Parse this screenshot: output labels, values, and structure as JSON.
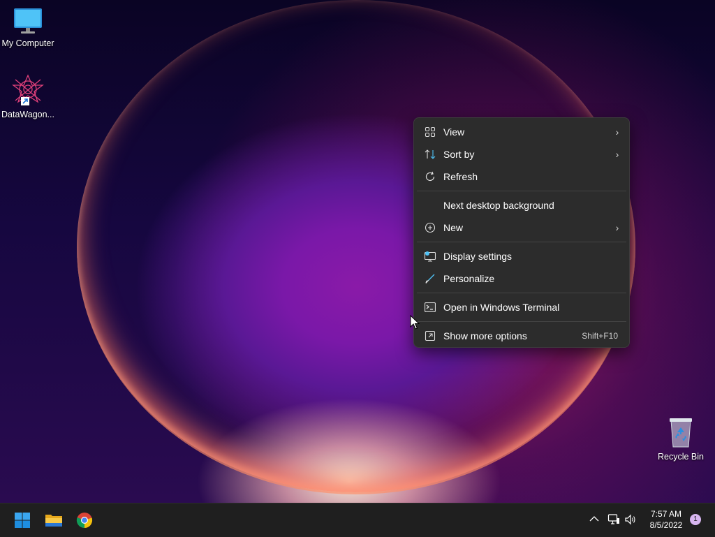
{
  "desktop": {
    "icons": [
      {
        "label": "My Computer",
        "icon": "monitor-icon"
      },
      {
        "label": "DataWagon...",
        "icon": "datawagon-app-icon"
      },
      {
        "label": "Recycle Bin",
        "icon": "recycle-bin-icon"
      }
    ]
  },
  "context_menu": {
    "items": [
      {
        "label": "View",
        "icon": "grid-view-icon",
        "submenu": true
      },
      {
        "label": "Sort by",
        "icon": "sort-icon",
        "submenu": true
      },
      {
        "label": "Refresh",
        "icon": "refresh-icon"
      },
      {
        "label": "Next desktop background"
      },
      {
        "label": "New",
        "icon": "plus-circle-icon",
        "submenu": true
      },
      {
        "label": "Display settings",
        "icon": "display-settings-icon"
      },
      {
        "label": "Personalize",
        "icon": "brush-icon"
      },
      {
        "label": "Open in Windows Terminal",
        "icon": "terminal-icon"
      },
      {
        "label": "Show more options",
        "icon": "more-options-icon",
        "shortcut": "Shift+F10"
      }
    ]
  },
  "taskbar": {
    "apps": [
      {
        "name": "Start",
        "icon": "windows-start-icon"
      },
      {
        "name": "File Explorer",
        "icon": "folder-icon"
      },
      {
        "name": "Google Chrome",
        "icon": "chrome-icon"
      }
    ],
    "tray": {
      "icons": [
        "chevron-up-icon",
        "network-icon",
        "volume-icon"
      ],
      "time": "7:57 AM",
      "date": "8/5/2022",
      "notification_count": "1"
    }
  },
  "colors": {
    "menu_bg": "#2c2c2c",
    "taskbar_bg": "#1f1f1f",
    "accent_blue": "#0078d4"
  }
}
